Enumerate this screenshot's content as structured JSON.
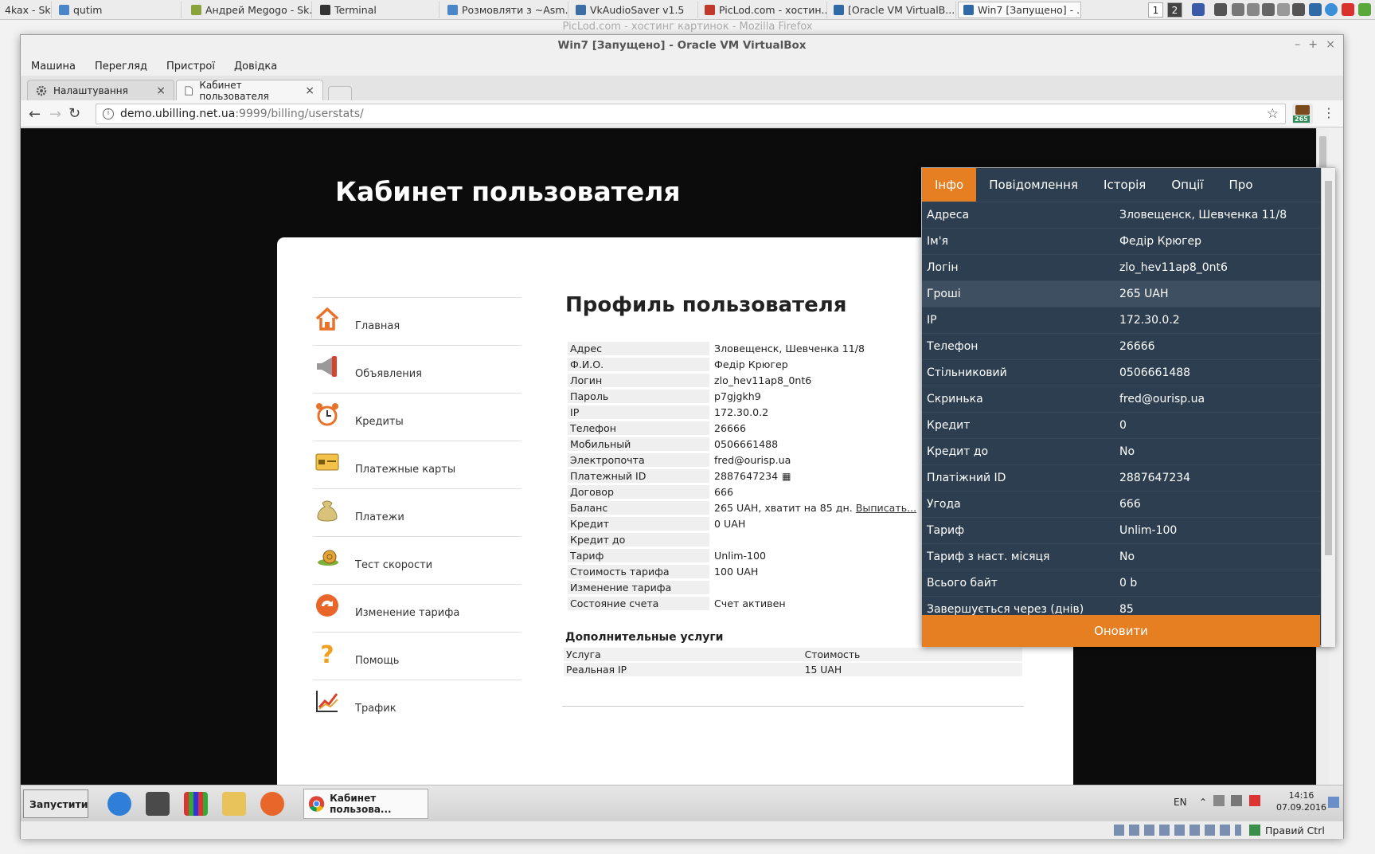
{
  "host_bar": {
    "tasks": [
      {
        "label": "4kax - Sk..."
      },
      {
        "label": "qutim"
      },
      {
        "label": "Андрей Megogo - Sk..."
      },
      {
        "label": "Terminal"
      },
      {
        "label": "Розмовляти з ~Asm..."
      },
      {
        "label": "VkAudioSaver v1.5"
      },
      {
        "label": "PicLod.com - хостин..."
      },
      {
        "label": "[Oracle VM VirtualB..."
      },
      {
        "label": "Win7 [Запущено] - ..."
      }
    ],
    "workspaces": [
      "1",
      "2"
    ]
  },
  "firefox_bg_title": "PicLod.com - хостинг картинок - Mozilla Firefox",
  "vbox": {
    "title": "Win7 [Запущено] - Oracle VM VirtualBox",
    "menu": [
      "Машина",
      "Перегляд",
      "Пристрої",
      "Довідка"
    ]
  },
  "chrome": {
    "tabs": [
      {
        "label": "Налаштування",
        "icon": "gear-icon"
      },
      {
        "label": "Кабинет пользователя",
        "icon": "page-icon"
      }
    ],
    "url_host": "demo.ubilling.net.ua",
    "url_rest": ":9999/billing/userstats/",
    "extension_badge": "265"
  },
  "page": {
    "title": "Кабинет пользователя",
    "nav": [
      {
        "label": "Главная",
        "icon": "home-icon"
      },
      {
        "label": "Объявления",
        "icon": "megaphone-icon"
      },
      {
        "label": "Кредиты",
        "icon": "alarm-clock-icon"
      },
      {
        "label": "Платежные карты",
        "icon": "card-icon"
      },
      {
        "label": "Платежи",
        "icon": "money-bag-icon"
      },
      {
        "label": "Тест скорости",
        "icon": "snail-icon"
      },
      {
        "label": "Изменение тарифа",
        "icon": "refresh-icon"
      },
      {
        "label": "Помощь",
        "icon": "question-icon"
      },
      {
        "label": "Трафик",
        "icon": "chart-icon"
      }
    ],
    "profile_heading": "Профиль пользователя",
    "profile": [
      {
        "k": "Адрес",
        "v": "Зловещенск, Шевченка 11/8"
      },
      {
        "k": "Ф.И.О.",
        "v": "Федір Крюгер"
      },
      {
        "k": "Логин",
        "v": "zlo_hev11ap8_0nt6"
      },
      {
        "k": "Пароль",
        "v": "p7gjgkh9"
      },
      {
        "k": "IP",
        "v": "172.30.0.2"
      },
      {
        "k": "Телефон",
        "v": "26666"
      },
      {
        "k": "Мобильный",
        "v": "0506661488"
      },
      {
        "k": "Электропочта",
        "v": "fred@ourisp.ua"
      },
      {
        "k": "Платежный ID",
        "v": "2887647234"
      },
      {
        "k": "Договор",
        "v": "666"
      },
      {
        "k": "Баланс",
        "v": "265 UAH, хватит на 85 дн.",
        "link": "Выписать..."
      },
      {
        "k": "Кредит",
        "v": "0 UAH"
      },
      {
        "k": "Кредит до",
        "v": ""
      },
      {
        "k": "Тариф",
        "v": "Unlim-100"
      },
      {
        "k": "Стоимость тарифа",
        "v": "100 UAH"
      },
      {
        "k": "Изменение тарифа",
        "v": ""
      },
      {
        "k": "Состояние счета",
        "v": "Счет активен"
      }
    ],
    "extra_heading": "Дополнительные услуги",
    "extra_header": {
      "service": "Услуга",
      "cost": "Стоимость"
    },
    "extra_rows": [
      {
        "service": "Реальная IP",
        "cost": "15 UAH"
      }
    ]
  },
  "popup": {
    "tabs": [
      "Інфо",
      "Повідомлення",
      "Історія",
      "Опції",
      "Про"
    ],
    "rows": [
      {
        "k": "Адреса",
        "v": "Зловещенск, Шевченка 11/8"
      },
      {
        "k": "Ім'я",
        "v": "Федір Крюгер"
      },
      {
        "k": "Логін",
        "v": "zlo_hev11ap8_0nt6"
      },
      {
        "k": "Гроші",
        "v": "265 UAH"
      },
      {
        "k": "IP",
        "v": "172.30.0.2"
      },
      {
        "k": "Телефон",
        "v": "26666"
      },
      {
        "k": "Стільниковий",
        "v": "0506661488"
      },
      {
        "k": "Скринька",
        "v": "fred@ourisp.ua"
      },
      {
        "k": "Кредит",
        "v": "0"
      },
      {
        "k": "Кредит до",
        "v": "No"
      },
      {
        "k": "Платіжний ID",
        "v": "2887647234"
      },
      {
        "k": "Угода",
        "v": "666"
      },
      {
        "k": "Тариф",
        "v": "Unlim-100"
      },
      {
        "k": "Тариф з наст. місяця",
        "v": "No"
      },
      {
        "k": "Всього байт",
        "v": "0 b"
      },
      {
        "k": "Завершується через (днів)",
        "v": "85"
      }
    ],
    "refresh_label": "Оновити"
  },
  "guest_taskbar": {
    "start_label": "Запустити",
    "active_window": "Кабинет пользова...",
    "lang": "EN",
    "time": "14:16",
    "date": "07.09.2016"
  },
  "vbox_status": {
    "host_key": "Правий Ctrl"
  }
}
